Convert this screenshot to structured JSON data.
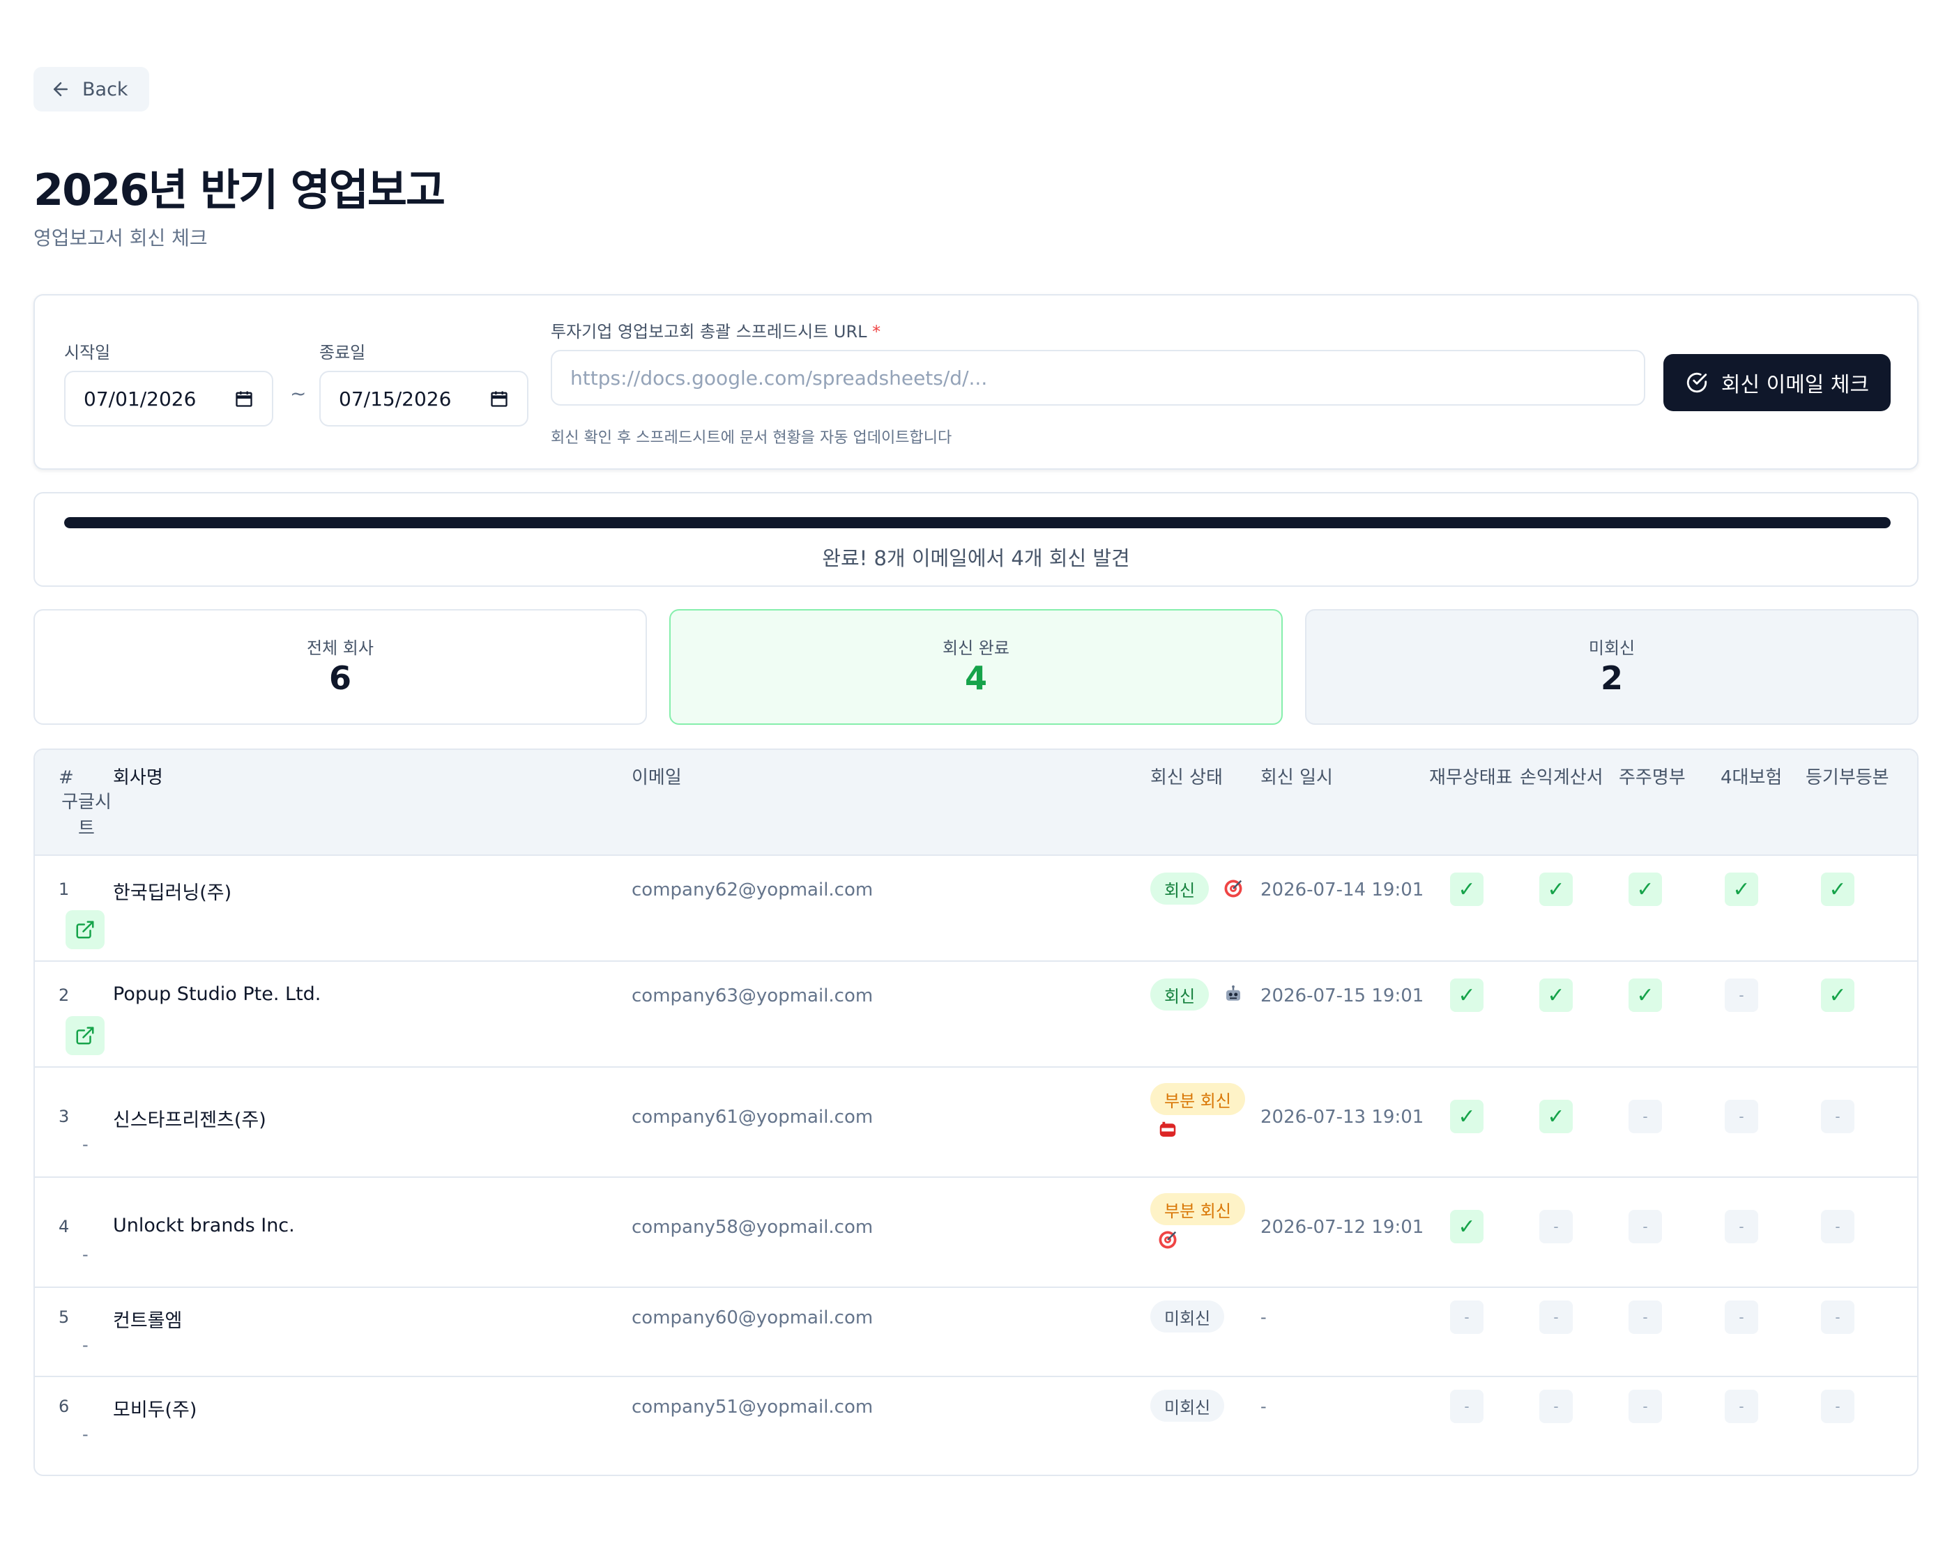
{
  "nav": {
    "back_label": "Back"
  },
  "page": {
    "title": "2026년 반기 영업보고",
    "subtitle": "영업보고서 회신 체크"
  },
  "form": {
    "start_label": "시작일",
    "start_value": "07/01/2026",
    "end_label": "종료일",
    "end_value": "07/15/2026",
    "range_sep": "~",
    "url_label": "투자기업 영업보고회 총괄 스프레드시트 URL",
    "url_required": "*",
    "url_placeholder": "https://docs.google.com/spreadsheets/d/...",
    "url_hint": "회신 확인 후 스프레드시트에 문서 현황을 자동 업데이트합니다",
    "submit_label": "회신 이메일 체크"
  },
  "progress": {
    "percent": 100,
    "text": "완료! 8개 이메일에서 4개 회신 발견"
  },
  "stats": {
    "total_label": "전체 회사",
    "total_value": "6",
    "replied_label": "회신 완료",
    "replied_value": "4",
    "pending_label": "미회신",
    "pending_value": "2"
  },
  "table": {
    "headers": {
      "num": "#",
      "sheet": "구글시트",
      "company": "회사명",
      "email": "이메일",
      "status": "회신 상태",
      "date": "회신 일시",
      "doc1": "재무상태표",
      "doc2": "손익계산서",
      "doc3": "주주명부",
      "doc4": "4대보험",
      "doc5": "등기부등본"
    },
    "rows": [
      {
        "num": "1",
        "company": "한국딥러닝(주)",
        "email": "company62@yopmail.com",
        "status": "회신",
        "status_type": "ok",
        "source_icon": "target-icon",
        "date": "2026-07-14 19:01",
        "sheet": "link",
        "docs": [
          true,
          true,
          true,
          true,
          true
        ]
      },
      {
        "num": "2",
        "company": "Popup Studio Pte. Ltd.",
        "email": "company63@yopmail.com",
        "status": "회신",
        "status_type": "ok",
        "source_icon": "robot-icon",
        "date": "2026-07-15 19:01",
        "sheet": "link",
        "docs": [
          true,
          true,
          true,
          false,
          true
        ]
      },
      {
        "num": "3",
        "company": "신스타프리젠츠(주)",
        "email": "company61@yopmail.com",
        "status": "부분 회신",
        "status_type": "partial",
        "source_icon": "mailbox-icon",
        "date": "2026-07-13 19:01",
        "sheet": "-",
        "docs": [
          true,
          true,
          false,
          false,
          false
        ]
      },
      {
        "num": "4",
        "company": "Unlockt brands Inc.",
        "email": "company58@yopmail.com",
        "status": "부분 회신",
        "status_type": "partial",
        "source_icon": "target-icon",
        "date": "2026-07-12 19:01",
        "sheet": "-",
        "docs": [
          true,
          false,
          false,
          false,
          false
        ]
      },
      {
        "num": "5",
        "company": "컨트롤엠",
        "email": "company60@yopmail.com",
        "status": "미회신",
        "status_type": "none",
        "source_icon": "",
        "date": "-",
        "sheet": "-",
        "docs": [
          false,
          false,
          false,
          false,
          false
        ]
      },
      {
        "num": "6",
        "company": "모비두(주)",
        "email": "company51@yopmail.com",
        "status": "미회신",
        "status_type": "none",
        "source_icon": "",
        "date": "-",
        "sheet": "-",
        "docs": [
          false,
          false,
          false,
          false,
          false
        ]
      }
    ],
    "check_mark": "✓",
    "missing_mark": "-"
  },
  "colors": {
    "primary": "#0f172a",
    "success": "#16a34a",
    "success_bg": "#dcfce7",
    "warning": "#d97706",
    "warning_bg": "#fef3c7",
    "muted_bg": "#f1f5f9"
  }
}
